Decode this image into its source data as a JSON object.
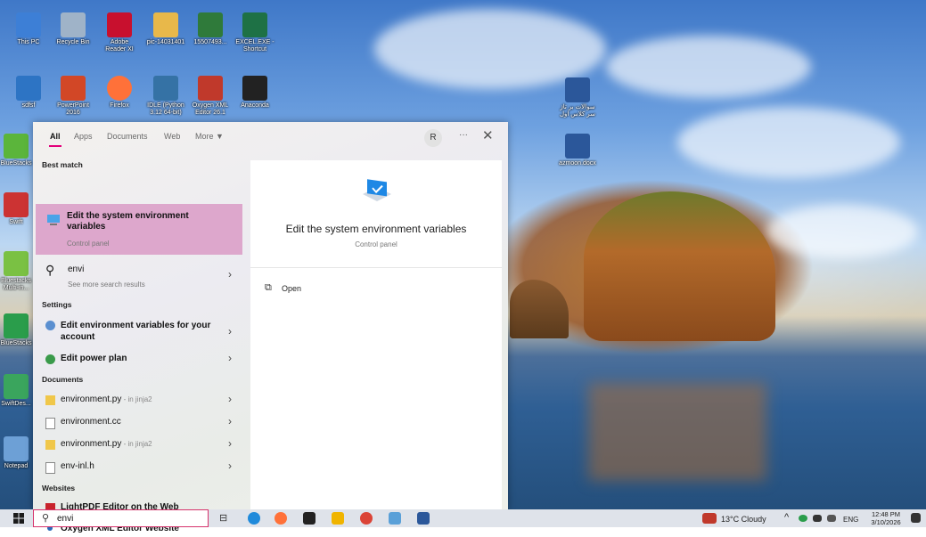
{
  "desktop": {
    "icons": [
      {
        "label": "This PC",
        "name": "this-pc-icon",
        "color": "#3d7fd6"
      },
      {
        "label": "Recycle Bin",
        "name": "recycle-bin-icon",
        "color": "#9fb3c8"
      },
      {
        "label": "Adobe Reader XI",
        "name": "adobe-reader-icon",
        "color": "#c8102e"
      },
      {
        "label": "pic-14031401",
        "name": "folder-icon",
        "color": "#e8b84a"
      },
      {
        "label": "15507493...",
        "name": "archive-icon",
        "color": "#2f7a3a"
      },
      {
        "label": "EXCEL.EXE - Shortcut",
        "name": "excel-icon",
        "color": "#1e7145"
      },
      {
        "label": "sdfsf",
        "name": "image-viewer-icon",
        "color": "#2d74c4"
      },
      {
        "label": "PowerPoint 2016",
        "name": "powerpoint-icon",
        "color": "#d24726"
      },
      {
        "label": "Firefox",
        "name": "firefox-icon",
        "color": "#ff7139"
      },
      {
        "label": "IDLE (Python 3.12 64-bit)",
        "name": "python-idle-icon",
        "color": "#3572a5"
      },
      {
        "label": "Oxygen XML Editor 26.1",
        "name": "oxygen-xml-icon",
        "color": "#c0392b"
      },
      {
        "label": "Anaconda",
        "name": "app-shortcut-icon",
        "color": "#222222"
      },
      {
        "label": "سوالات بر تاژ سر کلاس اول",
        "name": "word-document-icon",
        "color": "#2b579a"
      },
      {
        "label": "azmoon.docx",
        "name": "word-document-icon",
        "color": "#2b579a"
      },
      {
        "label": "BlueStacks",
        "name": "bluestacks-icon",
        "color": "#5bb53b"
      },
      {
        "label": "Swift",
        "name": "app-shortcut-icon",
        "color": "#cc3333"
      },
      {
        "label": "Bluestacks Multi-in...",
        "name": "bluestacks-multi-icon",
        "color": "#7ac143"
      },
      {
        "label": "BlueStacks",
        "name": "bluestacks-x-icon",
        "color": "#2a9d4b"
      },
      {
        "label": "SwiftDes...",
        "name": "swift-icon",
        "color": "#3aa55d"
      },
      {
        "label": "Notepad",
        "name": "notepad-icon",
        "color": "#6da0d6"
      }
    ]
  },
  "search_panel": {
    "tabs": [
      "All",
      "Apps",
      "Documents",
      "Web",
      "More ▼"
    ],
    "avatar_initial": "R",
    "more_dots": "···",
    "close": "✕",
    "sections": {
      "best_match": "Best match",
      "settings": "Settings",
      "documents": "Documents",
      "websites": "Websites"
    },
    "best_match": {
      "title": "Edit the system environment variables",
      "sub": "Control panel"
    },
    "web_suggestion": {
      "title": "envi",
      "sub": "See more search results"
    },
    "settings_items": [
      {
        "title": "Edit environment variables for your account"
      },
      {
        "title": "Edit power plan"
      }
    ],
    "documents": [
      {
        "title": "environment.py",
        "suffix": " - in jinja2"
      },
      {
        "title": "environment.cc",
        "suffix": ""
      },
      {
        "title": "environment.py",
        "suffix": " - in jinja2"
      },
      {
        "title": "env-inl.h",
        "suffix": ""
      }
    ],
    "websites": [
      {
        "title": "LightPDF Editor on the Web"
      },
      {
        "title": "Oxygen XML Editor Website"
      }
    ],
    "preview": {
      "title": "Edit the system environment variables",
      "sub": "Control panel",
      "action": "Open"
    }
  },
  "taskbar": {
    "search_value": "envi",
    "weather": "13°C  Cloudy",
    "language": "ENG",
    "time": "12:48 PM",
    "date": "3/10/2026"
  }
}
